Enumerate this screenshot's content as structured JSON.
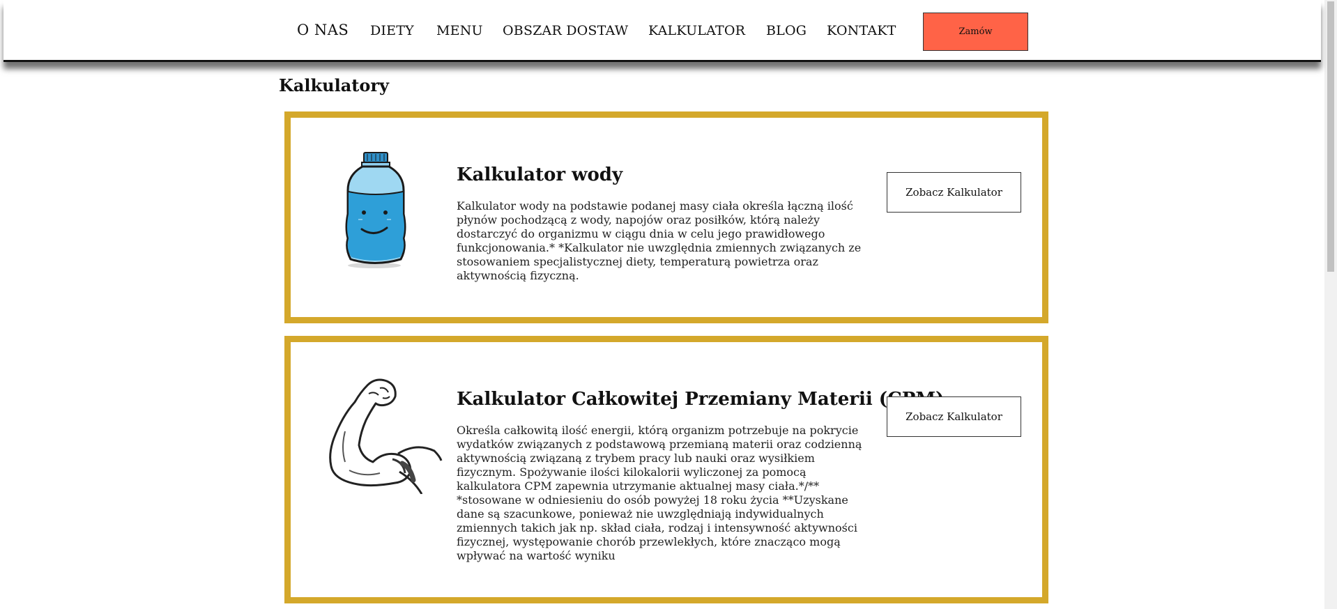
{
  "nav": {
    "items": [
      "O NAS",
      "DIETY",
      "MENU",
      "OBSZAR DOSTAW",
      "KALKULATOR",
      "BLOG",
      "KONTAKT"
    ],
    "order_button": "Zamów",
    "order_color": "#ff6347"
  },
  "page": {
    "title": "Kalkulatory"
  },
  "cards": [
    {
      "title": "Kalkulator wody",
      "description": "Kalkulator wody na podstawie podanej masy ciała określa łączną ilość płynów pochodzącą z wody, napojów oraz posiłków, którą należy dostarczyć do organizmu w ciągu dnia w celu jego prawidłowego funkcjonowania.* *Kalkulator nie uwzględnia zmiennych związanych ze stosowaniem specjalistycznej diety, temperaturą powietrza oraz aktywnością fizyczną.",
      "button": "Zobacz Kalkulator",
      "icon": "water-bottle-icon"
    },
    {
      "title": "Kalkulator Całkowitej Przemiany Materii (CPM)",
      "description": "Określa całkowitą ilość energii, którą organizm potrzebuje na pokrycie wydatków związanych z podstawową przemianą materii oraz codzienną aktywnością związaną z trybem pracy lub nauki oraz wysiłkiem fizycznym. Spożywanie ilości kilokalorii wyliczonej za pomocą kalkulatora CPM zapewnia utrzymanie aktualnej masy ciała.*/** *stosowane w odniesieniu do osób powyżej 18 roku życia **Uzyskane dane są szacunkowe, ponieważ nie uwzględniają indywidualnych zmiennych takich jak np. skład ciała, rodzaj i intensywność aktywności fizycznej, występowanie chorób przewlekłych, które znacząco mogą wpływać na wartość wyniku",
      "button": "Zobacz Kalkulator",
      "icon": "flexed-arm-icon"
    }
  ],
  "colors": {
    "card_border": "#d4a82b",
    "bottle_blue": "#3aa3dc"
  }
}
